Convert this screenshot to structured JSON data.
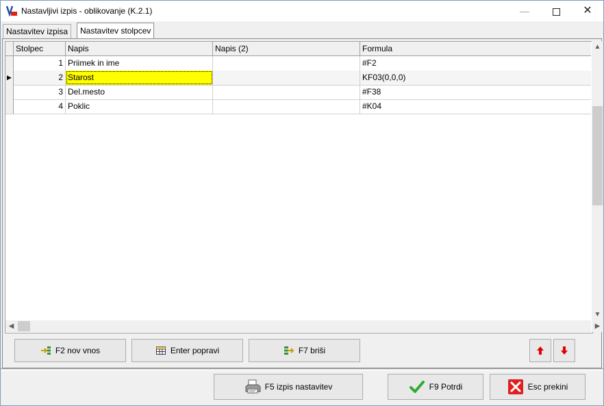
{
  "window": {
    "title": "Nastavljivi izpis - oblikovanje  (K.2.1)",
    "min_symbol": "—",
    "close_symbol": "✕"
  },
  "tabs": [
    {
      "label": "Nastavitev izpisa"
    },
    {
      "label": "Nastavitev stolpcev"
    }
  ],
  "grid": {
    "columns": [
      "Stolpec",
      "Napis",
      "Napis (2)",
      "Formula"
    ],
    "rows": [
      {
        "num": "1",
        "napis": "Priimek in ime",
        "napis2": "",
        "formula": "#F2"
      },
      {
        "num": "2",
        "napis": "Starost",
        "napis2": "",
        "formula": "KF03(0,0,0)"
      },
      {
        "num": "3",
        "napis": "Del.mesto",
        "napis2": "",
        "formula": "#F38"
      },
      {
        "num": "4",
        "napis": "Poklic",
        "napis2": "",
        "formula": "#K04"
      }
    ],
    "current_row_marker": "▶"
  },
  "toolbar": {
    "new_label": "F2 nov vnos",
    "edit_label": "Enter popravi",
    "delete_label": "F7 briši"
  },
  "footer": {
    "print_label": "F5 izpis nastavitev",
    "confirm_label": "F9 Potrdi",
    "cancel_label": "Esc  prekini"
  },
  "colors": {
    "selected_cell": "#ffff00",
    "up_down_arrow": "#e00000",
    "confirm_check": "#2faa2f",
    "cancel_x": "#e02020"
  }
}
